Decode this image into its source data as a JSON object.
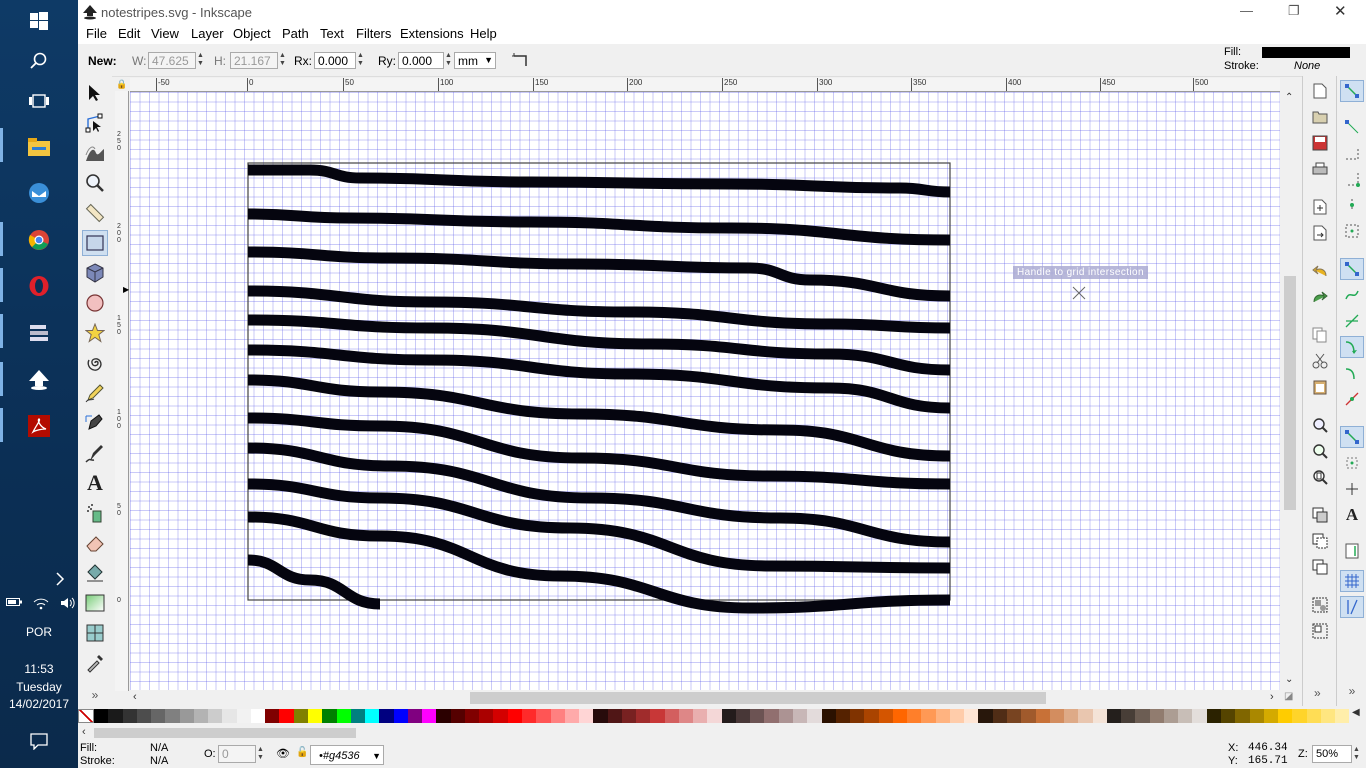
{
  "window": {
    "title": "notestripes.svg - Inkscape",
    "min": "—",
    "max": "❐",
    "close": "✕"
  },
  "menu": [
    "File",
    "Edit",
    "View",
    "Layer",
    "Object",
    "Path",
    "Text",
    "Filters",
    "Extensions",
    "Help"
  ],
  "controls": {
    "new_label": "New:",
    "w_label": "W:",
    "w_value": "47.625",
    "h_label": "H:",
    "h_value": "21.167",
    "rx_label": "Rx:",
    "rx_value": "0.000",
    "ry_label": "Ry:",
    "ry_value": "0.000",
    "unit": "mm",
    "fill_label": "Fill:",
    "fill_color": "#000000",
    "stroke_label": "Stroke:",
    "stroke_value": "None"
  },
  "ruler_top_labels": [
    "-50",
    "0",
    "50",
    "100",
    "150",
    "200",
    "250",
    "300",
    "350",
    "400",
    "450",
    "500"
  ],
  "ruler_left_labels": [
    "2\n5\n0",
    "2\n0\n0",
    "1\n5\n0",
    "1\n0\n0",
    "5\n0",
    "0"
  ],
  "canvas": {
    "tooltip": "Handle to grid intersection",
    "stripe_color": "#05050f"
  },
  "taskbar": {
    "lang": "POR",
    "time": "11:53",
    "day": "Tuesday",
    "date": "14/02/2017"
  },
  "status": {
    "fill_label": "Fill:",
    "fill_value": "N/A",
    "stroke_label": "Stroke:",
    "stroke_value": "N/A",
    "opacity_label": "O:",
    "opacity_value": "0",
    "layer_name": "•#g4536",
    "x_label": "X:",
    "x_value": "446.34",
    "y_label": "Y:",
    "y_value": "165.71",
    "zoom_label": "Z:",
    "zoom_value": "50%"
  },
  "palette_colors": [
    "#000000",
    "#1a1a1a",
    "#333333",
    "#4d4d4d",
    "#666666",
    "#808080",
    "#999999",
    "#b3b3b3",
    "#cccccc",
    "#e6e6e6",
    "#f2f2f2",
    "#ffffff",
    "#800000",
    "#ff0000",
    "#808000",
    "#ffff00",
    "#008000",
    "#00ff00",
    "#008080",
    "#00ffff",
    "#000080",
    "#0000ff",
    "#800080",
    "#ff00ff",
    "#2b0000",
    "#550000",
    "#800000",
    "#aa0000",
    "#d40000",
    "#ff0000",
    "#ff2a2a",
    "#ff5555",
    "#ff8080",
    "#ffaaaa",
    "#ffd5d5",
    "#280b0b",
    "#501616",
    "#782121",
    "#a02c2c",
    "#c83737",
    "#d35f5f",
    "#de8787",
    "#e9afaf",
    "#f4d7d7",
    "#241c1c",
    "#483737",
    "#6c5353",
    "#916f6f",
    "#ac9393",
    "#c8b7b7",
    "#e3dbdb",
    "#2b1100",
    "#552200",
    "#803300",
    "#aa4400",
    "#d45500",
    "#ff6600",
    "#ff7f2a",
    "#ff9955",
    "#ffb380",
    "#ffccaa",
    "#ffe6d5",
    "#28170b",
    "#502d16",
    "#784421",
    "#a05a2c",
    "#c87137",
    "#d38d5f",
    "#deaa87",
    "#e9c6af",
    "#f4e3d7",
    "#241f1c",
    "#483e37",
    "#6c5d53",
    "#917c6f",
    "#ac9d93",
    "#c8beb7",
    "#e3dedb",
    "#2b2200",
    "#554400",
    "#806600",
    "#aa8800",
    "#d4aa00",
    "#ffcc00",
    "#ffd42a",
    "#ffdd55",
    "#ffe680",
    "#ffeeaa"
  ]
}
